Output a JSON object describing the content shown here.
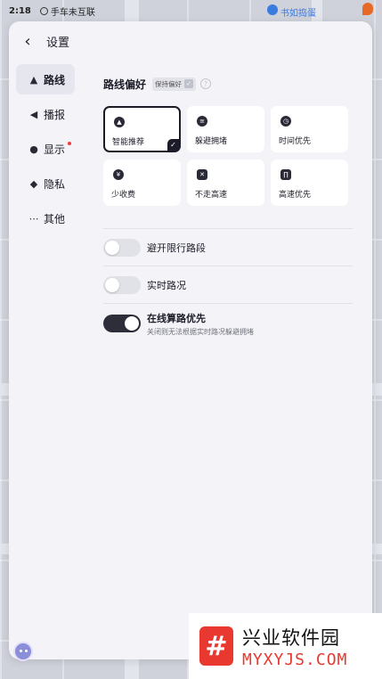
{
  "status_bar": {
    "time": "2:18",
    "carlink_label": "手车未互联"
  },
  "map": {
    "pin_label": "书如捣蛋"
  },
  "settings": {
    "title": "设置",
    "nav": [
      {
        "label": "路线",
        "icon": "navigate-arrow-icon",
        "active": true
      },
      {
        "label": "播报",
        "icon": "speaker-icon",
        "active": false
      },
      {
        "label": "显示",
        "icon": "location-pin-icon",
        "active": false,
        "badge": true
      },
      {
        "label": "隐私",
        "icon": "shield-icon",
        "active": false
      },
      {
        "label": "其他",
        "icon": "more-dots-icon",
        "active": false
      }
    ],
    "route_pref": {
      "title": "路线偏好",
      "keep_label": "保持偏好",
      "help": "?",
      "options": [
        {
          "label": "智能推荐",
          "icon": "thumbs-up-icon",
          "selected": true
        },
        {
          "label": "躲避拥堵",
          "icon": "congestion-icon",
          "selected": false
        },
        {
          "label": "时间优先",
          "icon": "clock-icon",
          "selected": false
        },
        {
          "label": "少收费",
          "icon": "yen-icon",
          "selected": false
        },
        {
          "label": "不走高速",
          "icon": "no-highway-icon",
          "selected": false
        },
        {
          "label": "高速优先",
          "icon": "highway-icon",
          "selected": false
        }
      ]
    },
    "toggles": [
      {
        "label": "避开限行路段",
        "on": false,
        "desc": ""
      },
      {
        "label": "实时路况",
        "on": false,
        "desc": ""
      },
      {
        "label": "在线算路优先",
        "on": true,
        "desc": "关闭则无法根据实时路况躲避拥堵"
      }
    ]
  },
  "watermark": {
    "title": "兴业软件园",
    "subtitle": "MYXYJS.COM",
    "logo_glyph": "#"
  }
}
